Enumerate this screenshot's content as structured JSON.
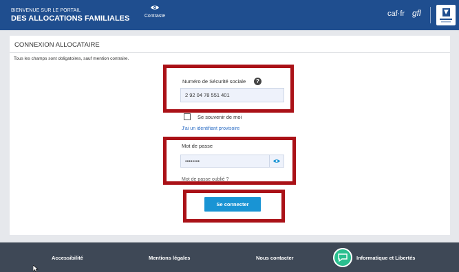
{
  "header": {
    "brand_small": "BIENVENUE SUR LE PORTAIL",
    "brand_big": "DES ALLOCATIONS FAMILIALES",
    "contrast_label": "Contraste",
    "caf_logo": "caf·fr",
    "gdpr_logo": "gfl"
  },
  "main": {
    "title": "CONNEXION ALLOCATAIRE",
    "required_note": "Tous les champs sont obligatoires, sauf mention contraire.",
    "nss": {
      "label": "Numéro de Sécurité sociale",
      "value": "2 92 04 78 551 401"
    },
    "remember_label": "Se souvenir de moi",
    "provisional_link": "J'ai un identifiant provisoire",
    "password": {
      "label": "Mot de passe",
      "value": "••••••••"
    },
    "forgot_link": "Mot de passe oublié ?",
    "login_button": "Se connecter"
  },
  "footer": {
    "accessibility": "Accessibilité",
    "legal": "Mentions légales",
    "contact": "Nous contacter",
    "privacy": "Informatique et Libertés"
  },
  "colors": {
    "header_bg": "#1f4e8f",
    "button_bg": "#1994d4",
    "highlight_frame": "#aa1117",
    "footer_bg": "#3e4856",
    "cnil_badge": "#2bbf8f"
  },
  "icons": {
    "contrast": "eye-icon",
    "help": "question-icon",
    "show_password": "eye-icon",
    "cnil": "chat-bubble-icon"
  }
}
